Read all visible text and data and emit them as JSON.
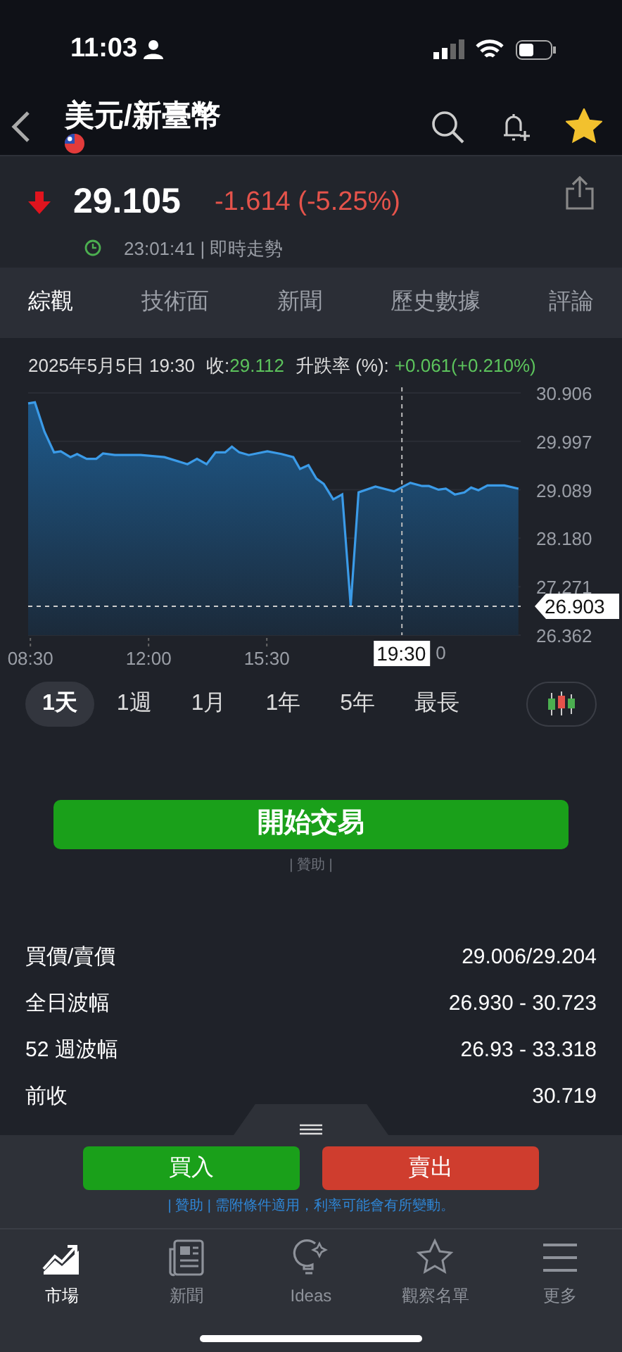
{
  "status_bar": {
    "time": "11:03"
  },
  "header": {
    "title": "美元/新臺幣",
    "favorite": true
  },
  "quote": {
    "price": "29.105",
    "change": "-1.614 (-5.25%)",
    "falling": true,
    "time": "23:01:41 | 即時走勢"
  },
  "tabs": [
    {
      "label": "綜觀",
      "selected": true
    },
    {
      "label": "技術面",
      "selected": false
    },
    {
      "label": "新聞",
      "selected": false
    },
    {
      "label": "歷史數據",
      "selected": false
    },
    {
      "label": "評論",
      "selected": false
    }
  ],
  "chart_info": {
    "date": "2025年5月5日 19:30",
    "close_label": "收:",
    "close": "29.112",
    "change_label": "升跌率 (%):",
    "change": "+0.061(+0.210%)"
  },
  "chart_data": {
    "type": "area",
    "x": [
      506,
      518,
      535,
      552,
      564,
      581,
      593,
      610,
      627,
      639,
      660,
      706,
      748,
      789,
      806,
      823,
      839,
      856,
      868,
      881,
      898,
      931,
      956,
      977,
      989,
      1004,
      1018,
      1031,
      1048,
      1064,
      1079,
      1093,
      1123,
      1156,
      1185,
      1206,
      1218,
      1235,
      1248,
      1264,
      1281,
      1293,
      1306,
      1322,
      1352,
      1377
    ],
    "series": [
      {
        "color": "#3b9be8",
        "values": [
          30.71,
          30.73,
          30.18,
          29.79,
          29.81,
          29.7,
          29.76,
          29.67,
          29.67,
          29.77,
          29.74,
          29.74,
          29.7,
          29.57,
          29.67,
          29.57,
          29.79,
          29.79,
          29.9,
          29.79,
          29.74,
          29.81,
          29.76,
          29.7,
          29.48,
          29.55,
          29.3,
          29.2,
          28.91,
          29.0,
          26.91,
          29.04,
          29.15,
          29.06,
          29.22,
          29.16,
          29.16,
          29.09,
          29.11,
          29.0,
          29.04,
          29.13,
          29.08,
          29.17,
          29.17,
          29.11
        ]
      }
    ],
    "xlim": [
      506,
      1381
    ],
    "ylim": [
      26.362,
      30.906
    ],
    "xticks": [
      {
        "value": 510,
        "label": "08:30"
      },
      {
        "value": 720,
        "label": "12:00"
      },
      {
        "value": 930,
        "label": "15:30"
      }
    ],
    "yticks": [
      {
        "value": 30.906,
        "label": "30.906"
      },
      {
        "value": 29.997,
        "label": "29.997"
      },
      {
        "value": 29.089,
        "label": "29.089"
      },
      {
        "value": 28.18,
        "label": "28.180"
      },
      {
        "value": 27.271,
        "label": "27.271"
      },
      {
        "value": 26.362,
        "label": "26.362"
      }
    ],
    "grid": true,
    "ref_lines": [
      {
        "axis": "y",
        "value": 26.903,
        "label": "26.903"
      },
      {
        "axis": "x",
        "value": 1170
      }
    ]
  },
  "crosshair_time": "19:30",
  "covered_tick_fragment": "0",
  "ranges": [
    {
      "label": "1天",
      "selected": true
    },
    {
      "label": "1週",
      "selected": false
    },
    {
      "label": "1月",
      "selected": false
    },
    {
      "label": "1年",
      "selected": false
    },
    {
      "label": "5年",
      "selected": false
    },
    {
      "label": "最長",
      "selected": false
    }
  ],
  "trade_button": {
    "label": "開始交易",
    "note": "| 贊助 |"
  },
  "stats": [
    {
      "label": "買價/賣價",
      "value": "29.006/29.204"
    },
    {
      "label": "全日波幅",
      "value": "26.930 - 30.723"
    },
    {
      "label": "52 週波幅",
      "value": "26.93 - 33.318"
    },
    {
      "label": "前收",
      "value": "30.719"
    }
  ],
  "actions": [
    {
      "label": "買入",
      "kind": "buy"
    },
    {
      "label": "賣出",
      "kind": "sell"
    }
  ],
  "disclaimer": "| 贊助 | 需附條件適用，利率可能會有所變動。",
  "nav": [
    {
      "label": "市場",
      "kind": "market",
      "selected": true
    },
    {
      "label": "新聞",
      "kind": "news",
      "selected": false
    },
    {
      "label": "Ideas",
      "kind": "ideas",
      "selected": false
    },
    {
      "label": "觀察名單",
      "kind": "watchlist",
      "selected": false
    },
    {
      "label": "更多",
      "kind": "more",
      "selected": false
    }
  ]
}
